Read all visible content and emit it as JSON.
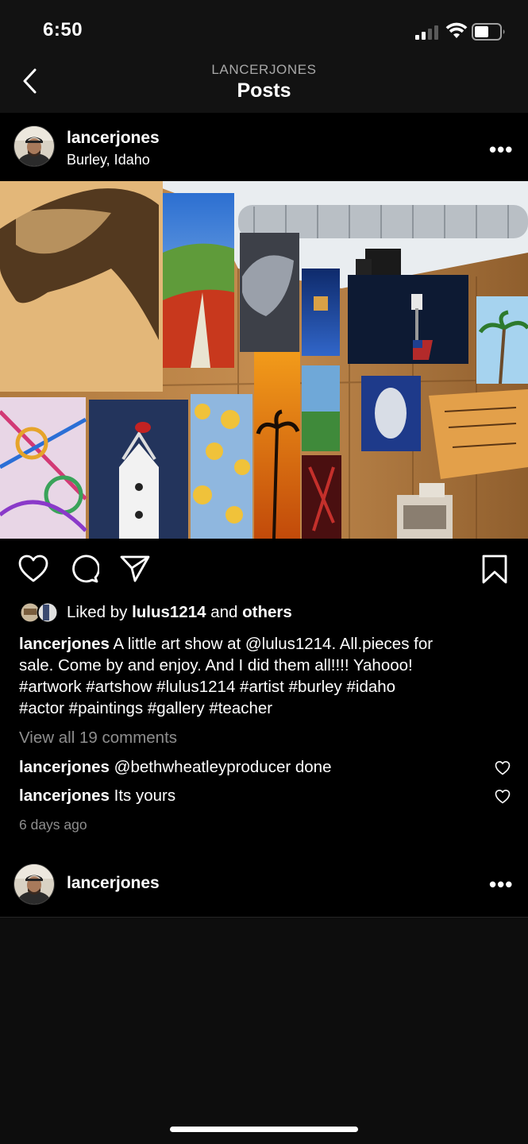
{
  "status_bar": {
    "time": "6:50"
  },
  "nav": {
    "subtitle": "LANCERJONES",
    "title": "Posts"
  },
  "post": {
    "username": "lancerjones",
    "location": "Burley, Idaho",
    "more": "•••",
    "liked_prefix": "Liked by ",
    "liked_user": "lulus1214",
    "liked_and": " and ",
    "liked_others": "others",
    "caption_user": "lancerjones",
    "caption_lines": [
      " A little art show at @lulus1214. All.pieces for",
      "sale. Come by and enjoy.  And I did them all!!!! Yahooo!",
      "#artwork #artshow #lulus1214 #artist #burley #idaho",
      "#actor #paintings #gallery #teacher"
    ],
    "view_comments": "View all 19 comments",
    "comments": [
      {
        "user": "lancerjones",
        "text": " @bethwheatleyproducer done"
      },
      {
        "user": "lancerjones",
        "text": " Its yours"
      }
    ],
    "timestamp": "6 days ago"
  },
  "next_post": {
    "username": "lancerjones",
    "more": "•••"
  }
}
